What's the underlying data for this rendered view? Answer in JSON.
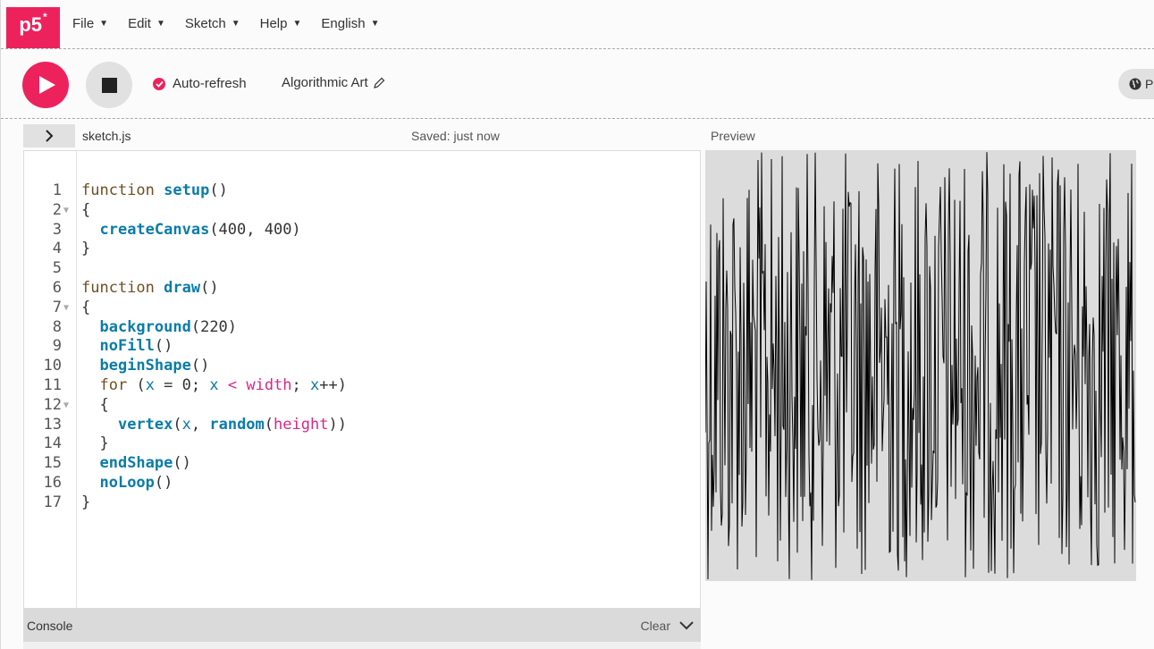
{
  "nav": {
    "logo": "p5",
    "logo_sup": "*",
    "menu": [
      {
        "label": "File"
      },
      {
        "label": "Edit"
      },
      {
        "label": "Sketch"
      },
      {
        "label": "Help"
      },
      {
        "label": "English"
      }
    ]
  },
  "toolbar": {
    "auto_refresh_label": "Auto-refresh",
    "auto_refresh_checked": true,
    "project_name": "Algorithmic Art",
    "preferences_label": "P"
  },
  "editor": {
    "file_name": "sketch.js",
    "saved_status": "Saved: just now",
    "lines": [
      "function setup()",
      "{",
      "  createCanvas(400, 400)",
      "}",
      "",
      "function draw()",
      "{",
      "  background(220)",
      "  noFill()",
      "  beginShape()",
      "  for (x = 0; x < width; x++)",
      "  {",
      "    vertex(x, random(height))",
      "  }",
      "  endShape()",
      "  noLoop()",
      "}"
    ],
    "fold_lines": [
      2,
      7,
      12
    ]
  },
  "preview": {
    "label": "Preview",
    "background": "#dcdcdc",
    "stroke": "#000000"
  },
  "console": {
    "title": "Console",
    "clear_label": "Clear"
  },
  "colors": {
    "accent": "#ed225d",
    "keyword": "#704f21",
    "function": "#0b7ca9",
    "p5_constant": "#d52889"
  }
}
